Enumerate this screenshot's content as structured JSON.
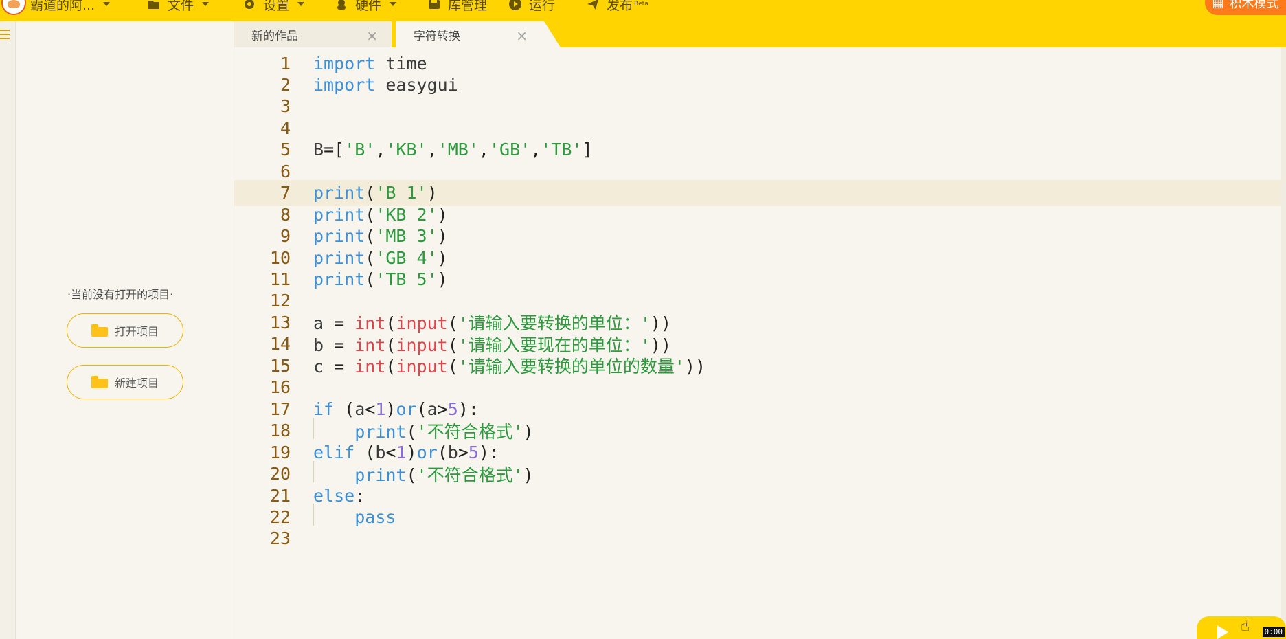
{
  "menu": {
    "user": "霸道的阿...",
    "file": "文件",
    "settings": "设置",
    "hardware": "硬件",
    "library": "库管理",
    "run": "运行",
    "publish": "发布",
    "publish_badge": "Beta",
    "mode_button": "积木模式"
  },
  "tabs": [
    {
      "label": "新的作品",
      "close": "×"
    },
    {
      "label": "字符转换",
      "close": "×"
    }
  ],
  "left_panel": {
    "empty_tip": "·当前没有打开的项目·",
    "open_project": "打开项目",
    "new_project": "新建项目"
  },
  "editor": {
    "current_line": 7,
    "lines": [
      {
        "n": "1",
        "t": "import time"
      },
      {
        "n": "2",
        "t": "import easygui"
      },
      {
        "n": "3",
        "t": ""
      },
      {
        "n": "4",
        "t": ""
      },
      {
        "n": "5",
        "t": "B=['B','KB','MB','GB','TB']"
      },
      {
        "n": "6",
        "t": ""
      },
      {
        "n": "7",
        "t": "print('B 1')"
      },
      {
        "n": "8",
        "t": "print('KB 2')"
      },
      {
        "n": "9",
        "t": "print('MB 3')"
      },
      {
        "n": "10",
        "t": "print('GB 4')"
      },
      {
        "n": "11",
        "t": "print('TB 5')"
      },
      {
        "n": "12",
        "t": ""
      },
      {
        "n": "13",
        "t": "a = int(input('请输入要转换的单位：'))"
      },
      {
        "n": "14",
        "t": "b = int(input('请输入要现在的单位：'))"
      },
      {
        "n": "15",
        "t": "c = int(input('请输入要转换的单位的数量'))"
      },
      {
        "n": "16",
        "t": ""
      },
      {
        "n": "17",
        "t": "if (a<1)or(a>5):"
      },
      {
        "n": "18",
        "t": "    print('不符合格式')"
      },
      {
        "n": "19",
        "t": "elif (b<1)or(b>5):"
      },
      {
        "n": "20",
        "t": "    print('不符合格式')"
      },
      {
        "n": "21",
        "t": "else:"
      },
      {
        "n": "22",
        "t": "    pass"
      },
      {
        "n": "23",
        "t": ""
      }
    ]
  },
  "timer": "0:00",
  "colors": {
    "topbar": "#ffd400",
    "keyword": "#3d8fd6",
    "builtin": "#e0474c",
    "string": "#2e9a3e",
    "number": "#8a6cd8",
    "line_number": "#8a5a12"
  }
}
